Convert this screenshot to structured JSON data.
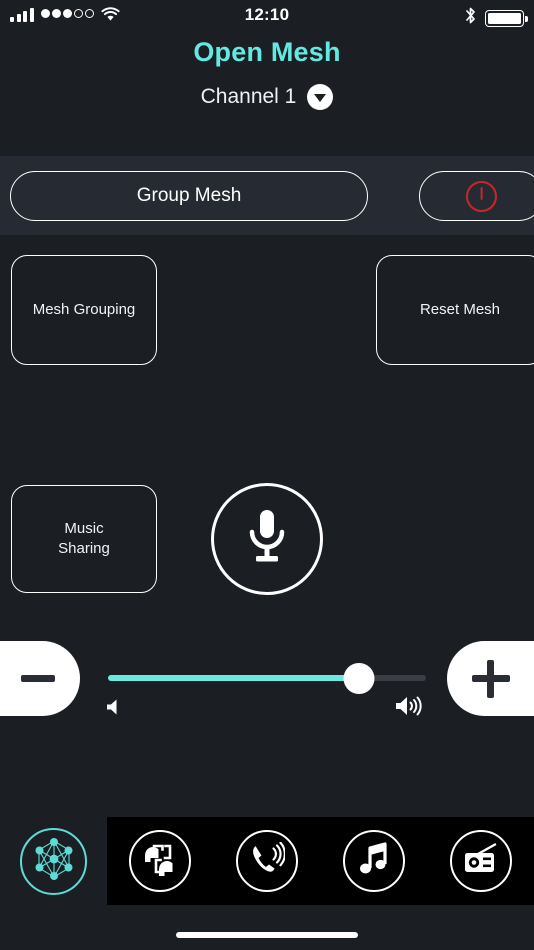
{
  "status_bar": {
    "time": "12:10",
    "signal_icon": "cellular-signal-icon",
    "dots_icon": "signal-dots-icon",
    "dots_filled": 3,
    "dots_total": 5,
    "wifi_icon": "wifi-icon",
    "bluetooth_icon": "bluetooth-icon",
    "battery_icon": "battery-full-icon"
  },
  "header": {
    "title": "Open Mesh",
    "title_color": "#63e8e2",
    "channel": "Channel 1",
    "channel_chevron_icon": "chevron-down-icon"
  },
  "band": {
    "group_mesh_label": "Group Mesh",
    "power_icon": "power-icon",
    "power_color": "#c62828"
  },
  "actions": {
    "mesh_grouping_label": "Mesh Grouping",
    "reset_mesh_label": "Reset Mesh",
    "music_sharing_label": "Music\nSharing",
    "music_sharing_line1": "Music",
    "music_sharing_line2": "Sharing",
    "mic_icon": "microphone-icon"
  },
  "volume": {
    "minus_icon": "minus-icon",
    "plus_icon": "plus-icon",
    "value_percent": 79,
    "fill_color": "#6ae9e2",
    "track_color": "#3a3d43",
    "low_icon": "volume-low-icon",
    "high_icon": "volume-high-icon"
  },
  "bottom_nav": {
    "active_item": "mesh-network-icon",
    "active_color": "#5ddcd6",
    "items": [
      {
        "icon": "intercom-icon",
        "label": "Intercom"
      },
      {
        "icon": "phone-call-icon",
        "label": "Phone"
      },
      {
        "icon": "music-note-icon",
        "label": "Music"
      },
      {
        "icon": "radio-icon",
        "label": "Radio"
      }
    ]
  },
  "home_indicator": "home-indicator"
}
